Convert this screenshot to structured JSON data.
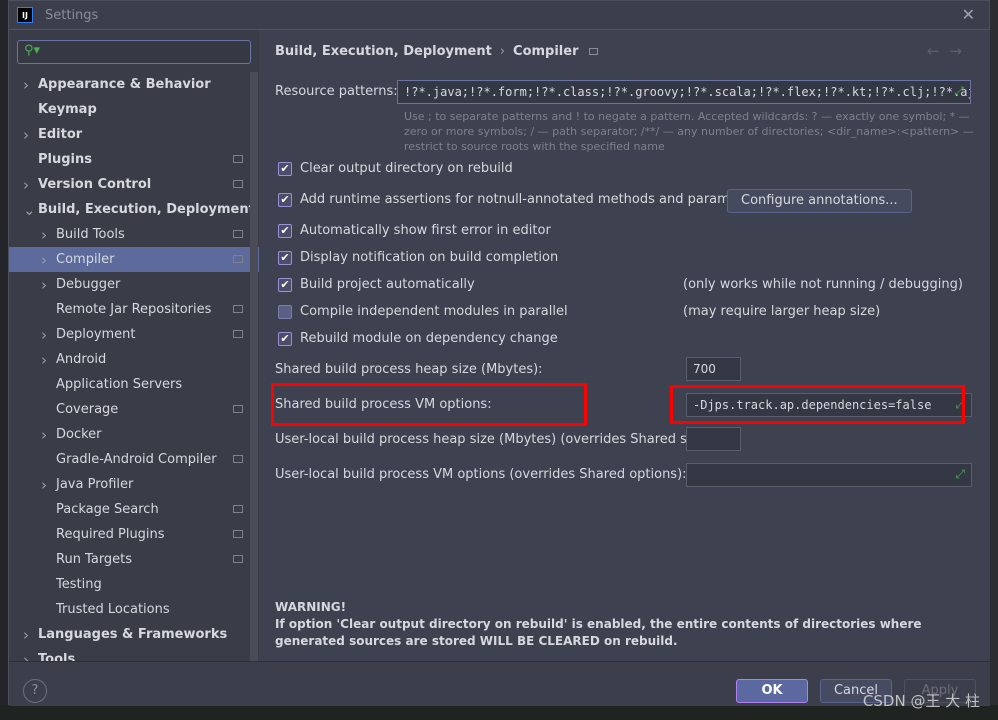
{
  "window": {
    "title": "Settings",
    "logo": "IJ"
  },
  "search": {
    "placeholder": ""
  },
  "sidebar": {
    "items": [
      {
        "label": "Appearance & Behavior",
        "level": 0,
        "chevron": true,
        "bold": true,
        "gear": false
      },
      {
        "label": "Keymap",
        "level": 0,
        "chevron": false,
        "bold": true,
        "gear": false
      },
      {
        "label": "Editor",
        "level": 0,
        "chevron": true,
        "bold": true,
        "gear": false
      },
      {
        "label": "Plugins",
        "level": 0,
        "chevron": false,
        "bold": true,
        "gear": true
      },
      {
        "label": "Version Control",
        "level": 0,
        "chevron": true,
        "bold": true,
        "gear": true
      },
      {
        "label": "Build, Execution, Deployment",
        "level": 0,
        "chevron": "open",
        "bold": true,
        "gear": false
      },
      {
        "label": "Build Tools",
        "level": 1,
        "chevron": true,
        "gear": true
      },
      {
        "label": "Compiler",
        "level": 1,
        "chevron": true,
        "gear": true,
        "selected": true
      },
      {
        "label": "Debugger",
        "level": 1,
        "chevron": true,
        "gear": false
      },
      {
        "label": "Remote Jar Repositories",
        "level": 1,
        "chevron": false,
        "gear": true
      },
      {
        "label": "Deployment",
        "level": 1,
        "chevron": true,
        "gear": true
      },
      {
        "label": "Android",
        "level": 1,
        "chevron": true,
        "gear": false
      },
      {
        "label": "Application Servers",
        "level": 1,
        "chevron": false,
        "gear": false
      },
      {
        "label": "Coverage",
        "level": 1,
        "chevron": false,
        "gear": true
      },
      {
        "label": "Docker",
        "level": 1,
        "chevron": true,
        "gear": false
      },
      {
        "label": "Gradle-Android Compiler",
        "level": 1,
        "chevron": false,
        "gear": true
      },
      {
        "label": "Java Profiler",
        "level": 1,
        "chevron": true,
        "gear": false
      },
      {
        "label": "Package Search",
        "level": 1,
        "chevron": false,
        "gear": true
      },
      {
        "label": "Required Plugins",
        "level": 1,
        "chevron": false,
        "gear": true
      },
      {
        "label": "Run Targets",
        "level": 1,
        "chevron": false,
        "gear": true
      },
      {
        "label": "Testing",
        "level": 1,
        "chevron": false,
        "gear": false
      },
      {
        "label": "Trusted Locations",
        "level": 1,
        "chevron": false,
        "gear": false
      },
      {
        "label": "Languages & Frameworks",
        "level": 0,
        "chevron": true,
        "bold": true,
        "gear": false
      },
      {
        "label": "Tools",
        "level": 0,
        "chevron": true,
        "bold": true,
        "gear": false
      }
    ]
  },
  "breadcrumb": {
    "parent": "Build, Execution, Deployment",
    "current": "Compiler",
    "separator": "›"
  },
  "resource": {
    "label": "Resource patterns:",
    "value": "!?*.java;!?*.form;!?*.class;!?*.groovy;!?*.scala;!?*.flex;!?*.kt;!?*.clj;!?*.aj",
    "hint": "Use ; to separate patterns and ! to negate a pattern. Accepted wildcards: ? — exactly one symbol; * — zero or more symbols; / — path separator; /**/ — any number of directories; <dir_name>:<pattern> — restrict to source roots with the specified name"
  },
  "checks": [
    {
      "label": "Clear output directory on rebuild",
      "checked": true
    },
    {
      "label": "Add runtime assertions for notnull-annotated methods and parameters",
      "checked": true
    },
    {
      "label": "Automatically show first error in editor",
      "checked": true
    },
    {
      "label": "Display notification on build completion",
      "checked": true
    },
    {
      "label": "Build project automatically",
      "checked": true
    },
    {
      "label": "Compile independent modules in parallel",
      "checked": false
    },
    {
      "label": "Rebuild module on dependency change",
      "checked": true
    }
  ],
  "configure_annotations": "Configure annotations...",
  "notes": {
    "auto": "(only works while not running / debugging)",
    "parallel": "(may require larger heap size)"
  },
  "heap": {
    "label": "Shared build process heap size (Mbytes):",
    "value": "700"
  },
  "vm": {
    "label": "Shared build process VM options:",
    "value": "-Djps.track.ap.dependencies=false"
  },
  "user_heap": {
    "label": "User-local build process heap size (Mbytes) (overrides Shared size):",
    "value": ""
  },
  "user_vm": {
    "label": "User-local build process VM options (overrides Shared options):",
    "value": ""
  },
  "warning": {
    "title": "WARNING!",
    "text": "If option 'Clear output directory on rebuild' is enabled, the entire contents of directories where generated sources are stored WILL BE CLEARED on rebuild."
  },
  "footer": {
    "help": "?",
    "ok": "OK",
    "cancel": "Cancel",
    "apply": "Apply"
  },
  "watermark": "CSDN @王 大 柱",
  "colors": {
    "selection": "#5d6a9c",
    "highlight": "#ff0000",
    "ok_border": "#b07ff0"
  }
}
